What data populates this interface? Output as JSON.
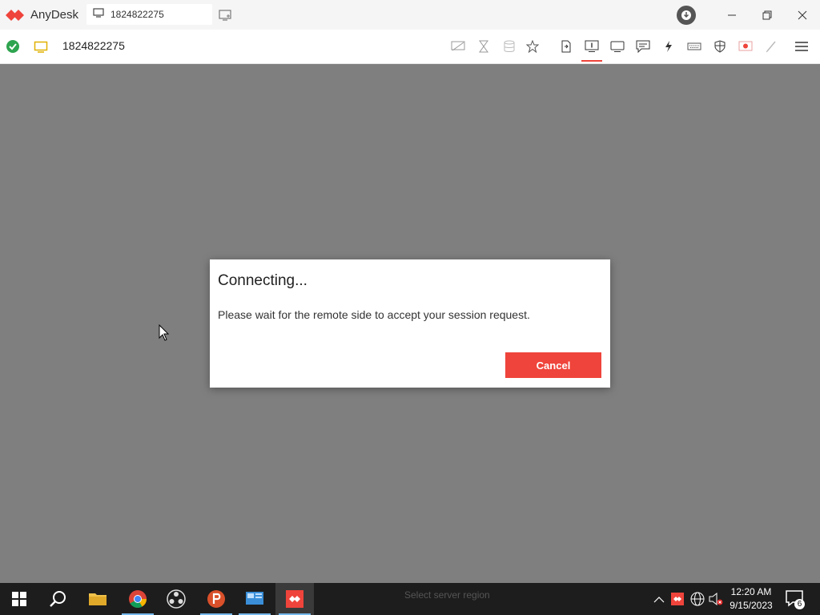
{
  "titlebar": {
    "app_name": "AnyDesk",
    "tab_label": "1824822275",
    "brand_color": "#ef443b"
  },
  "toolbar": {
    "address": "1824822275",
    "status_color": "#2ea44f",
    "icons": [
      "privacy-icon",
      "hourglass-icon",
      "database-icon",
      "star-icon",
      "file-transfer-icon",
      "monitor-one-icon",
      "display-icon",
      "chat-icon",
      "actions-icon",
      "keyboard-icon",
      "permissions-icon",
      "record-icon",
      "whiteboard-icon",
      "menu-icon"
    ]
  },
  "dialog": {
    "title": "Connecting...",
    "message": "Please wait for the remote side to accept your session request.",
    "cancel_label": "Cancel"
  },
  "taskbar": {
    "background_text": "Select server region",
    "time": "12:20 AM",
    "date": "9/15/2023",
    "notification_count": "6"
  }
}
